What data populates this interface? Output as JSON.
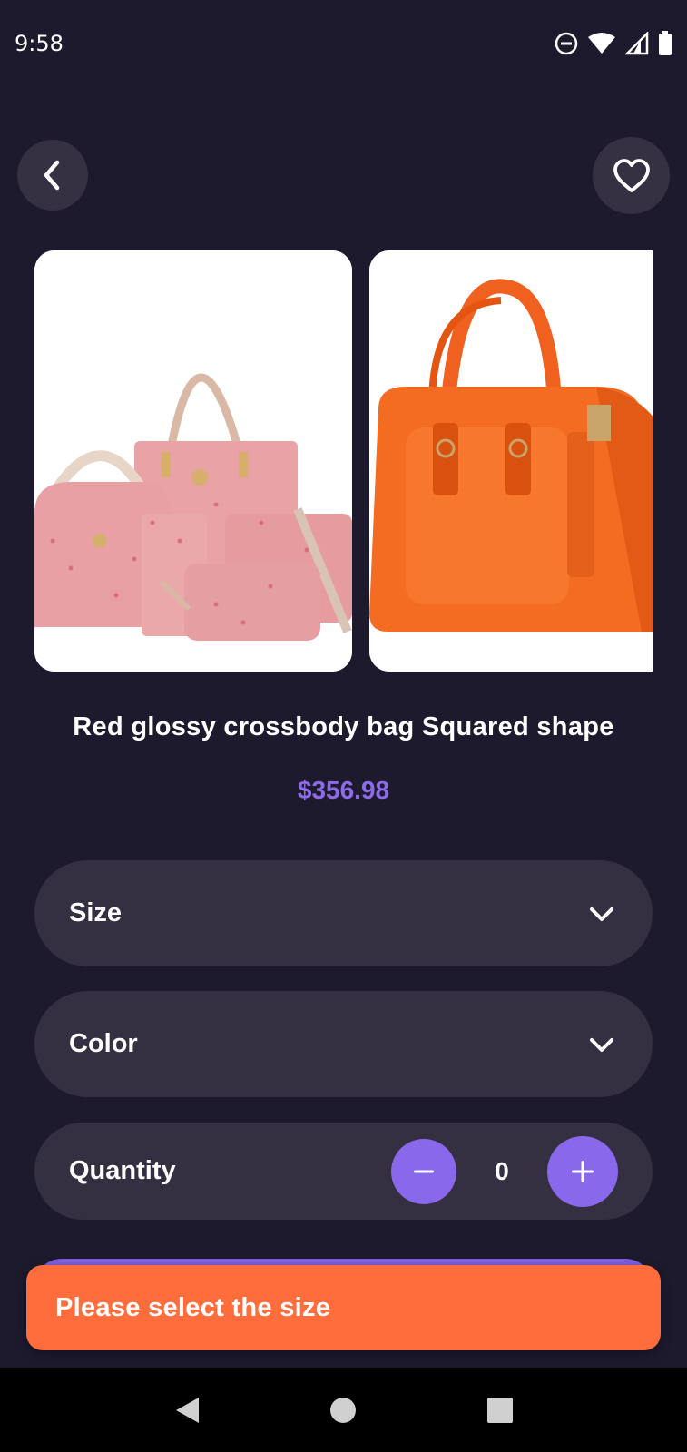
{
  "status_bar": {
    "time": "9:58",
    "icons": [
      "do-not-disturb-icon",
      "wifi-icon",
      "cellular-signal-icon",
      "battery-icon"
    ]
  },
  "header": {
    "back_icon": "chevron-left-icon",
    "favorite_icon": "heart-outline-icon"
  },
  "gallery": {
    "images": [
      {
        "name": "pink-handbag-set-image"
      },
      {
        "name": "orange-handbag-image"
      }
    ]
  },
  "product": {
    "title": "Red glossy crossbody bag Squared shape",
    "price": "$356.98"
  },
  "options": {
    "size_label": "Size",
    "color_label": "Color",
    "quantity_label": "Quantity",
    "quantity_value": "0"
  },
  "snackbar": {
    "message": "Please select the size"
  },
  "colors": {
    "background": "#1e1a2e",
    "surface": "#343041",
    "accent": "#8a68ec",
    "price": "#8b6be8",
    "snackbar": "#ff6d3c"
  }
}
